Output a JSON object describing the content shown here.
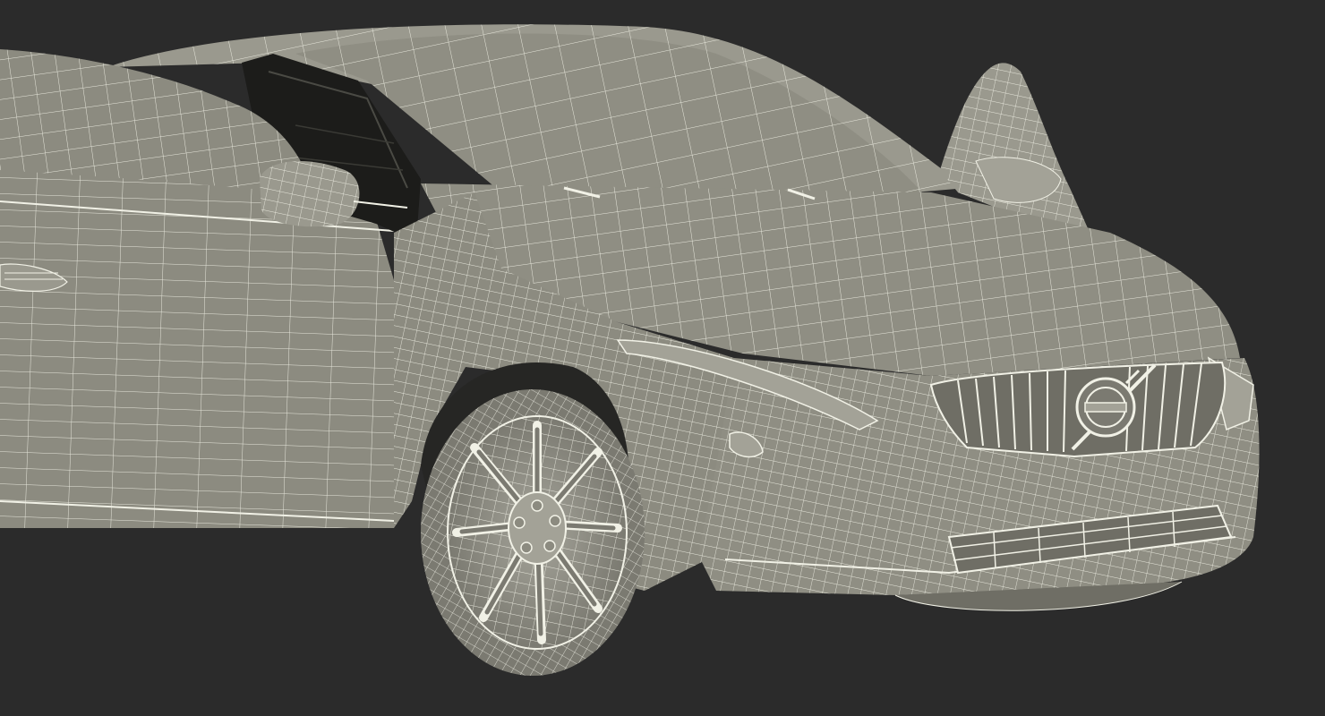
{
  "scene": {
    "subject": "car-wireframe-render",
    "colors": {
      "background": "#2b2b2b",
      "body": "#8c8b80",
      "body_light": "#a3a297",
      "body_dark": "#6f6e65",
      "wire": "#f1f1e6",
      "interior": "#1c1c1a",
      "wheel_well": "#262624",
      "tire": "#7b7a71"
    },
    "brand_emblem": "volvo-iron-mark"
  }
}
